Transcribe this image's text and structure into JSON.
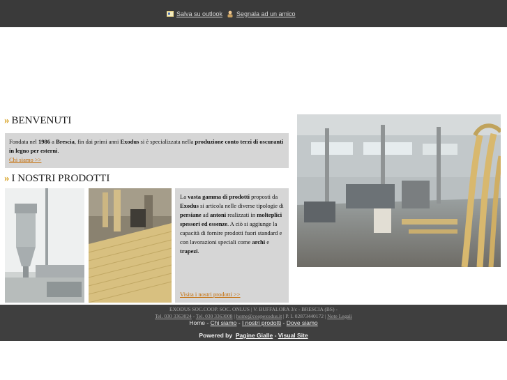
{
  "topbar": {
    "save_label": "Salva su outlook",
    "share_label": "Segnala ad un amico",
    "save_icon": "outlook-icon",
    "share_icon": "person-icon"
  },
  "welcome": {
    "title": "BENVENUTI",
    "text": {
      "t1": "Fondata nel ",
      "b1": "1986",
      "t2": " a ",
      "b2": "Brescia",
      "t3": ", fin dai primi anni ",
      "b3": "Exodus",
      "t4": " si è specializzata nella ",
      "b4": "produzione conto terzi di oscuranti in legno per esterni",
      "t5": "."
    },
    "link": "Chi siamo >>"
  },
  "products": {
    "title": "I NOSTRI PRODOTTI",
    "text": {
      "t1": "La ",
      "b1": "vasta gamma di prodotti",
      "t2": " proposti da ",
      "b2": "Exodus",
      "t3": " si articola nelle diverse tipologie di ",
      "b3": "persiane",
      "t4": " ad ",
      "b4": "antoni",
      "t5": " realizzati in ",
      "b5": "molteplici spessori ed essenze",
      "t6": ". A ciò si aggiunge la capacità di fornire prodotti fuori standard e con lavorazioni speciali come ",
      "b6": "archi",
      "t7": " e ",
      "b7": "trapezi",
      "t8": "."
    },
    "link": "Visita i nostri prodotti >>"
  },
  "footer": {
    "company": "EXODUS SOC.COOP. SOC. ONLUS | V. BUFFALORA 3/c - BRESCIA (BS) -",
    "tel1": "Tel. 030 3363024",
    "tel2": "Tel. 030 3363008",
    "email": "home@coopexodus.it",
    "vat": " | P. I. 02873440172 | ",
    "legal": "Note Legali",
    "nav": {
      "home": "Home",
      "about": "Chi siamo",
      "products": "I nostri prodotti",
      "where": "Dove siamo"
    },
    "powered_prefix": "Powered by",
    "powered_pg": "Pagine Gialle",
    "powered_vs": "Visual Site"
  },
  "colors": {
    "accent": "#d49a12",
    "link": "#c46a00",
    "topbar": "#3a3a3a",
    "box": "#d6d6d6"
  }
}
